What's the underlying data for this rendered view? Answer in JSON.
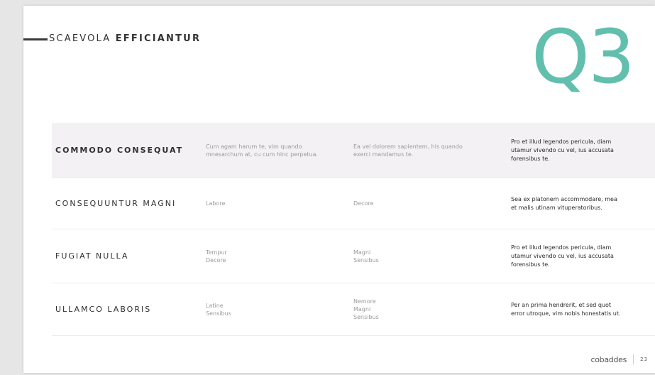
{
  "header": {
    "title_part1": "SCAEVOLA",
    "title_part2": "EFFICIANTUR",
    "quarter": "Q3"
  },
  "rows": [
    {
      "title": "COMMODO CONSEQUAT",
      "col_a": [
        "Cum agam harum te, vim quando",
        "mnesarchum at, cu cum hinc perpetua."
      ],
      "col_b": [
        "Ea vel dolorem sapientem, his quando",
        "exerci mandamus te."
      ],
      "col_c": [
        "Pro et illud legendos pericula, diam",
        "utamur vivendo cu vel, ius accusata",
        "forensibus te."
      ]
    },
    {
      "title": "CONSEQUUNTUR MAGNI",
      "col_a": [
        "Labore"
      ],
      "col_b": [
        "Decore"
      ],
      "col_c": [
        "Sea ex platonem accommodare, mea",
        "et malis utinam vituperatoribus."
      ]
    },
    {
      "title": "FUGIAT NULLA",
      "col_a": [
        "Tempur",
        "Decore"
      ],
      "col_b": [
        "Magni",
        "Sensibus"
      ],
      "col_c": [
        "Pro et illud legendos pericula, diam",
        "utamur vivendo cu vel, ius accusata",
        "forensibus te."
      ]
    },
    {
      "title": "ULLAMCO LABORIS",
      "col_a": [
        "Latine",
        "Sensibus"
      ],
      "col_b": [
        "Nemore",
        "Magni",
        "Sensibus"
      ],
      "col_c": [
        "Per an prima hendrerit, et sed quot",
        "error utroque, vim nobis honestatis ut."
      ]
    }
  ],
  "footer": {
    "brand": "cobaddes",
    "page_number": "23"
  },
  "colors": {
    "accent": "#62bfae",
    "row_shade": "#f4f1f4"
  }
}
